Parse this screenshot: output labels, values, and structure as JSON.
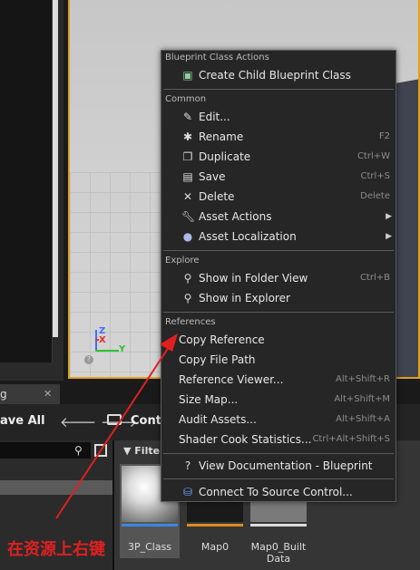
{
  "toolbar": {
    "tab_label": "g",
    "save_all": "ave All",
    "content": "Conte"
  },
  "assets": {
    "filters_label": "Filters",
    "items": [
      {
        "label": "3P_Class"
      },
      {
        "label": "Map0"
      },
      {
        "label": "Map0_Built Data"
      }
    ]
  },
  "context_menu": {
    "sections": {
      "blueprint": "Blueprint Class Actions",
      "common": "Common",
      "explore": "Explore",
      "references": "References"
    },
    "items": {
      "create_child": "Create Child Blueprint Class",
      "edit": "Edit...",
      "rename": "Rename",
      "rename_sc": "F2",
      "duplicate": "Duplicate",
      "duplicate_sc": "Ctrl+W",
      "save": "Save",
      "save_sc": "Ctrl+S",
      "delete": "Delete",
      "delete_sc": "Delete",
      "asset_actions": "Asset Actions",
      "asset_localization": "Asset Localization",
      "show_folder": "Show in Folder View",
      "show_folder_sc": "Ctrl+B",
      "show_explorer": "Show in Explorer",
      "copy_reference": "Copy Reference",
      "copy_file_path": "Copy File Path",
      "reference_viewer": "Reference Viewer...",
      "reference_viewer_sc": "Alt+Shift+R",
      "size_map": "Size Map...",
      "size_map_sc": "Alt+Shift+M",
      "audit_assets": "Audit Assets...",
      "audit_assets_sc": "Alt+Shift+A",
      "shader_cook": "Shader Cook Statistics...",
      "shader_cook_sc": "Ctrl+Alt+Shift+S",
      "view_docs": "View Documentation - Blueprint",
      "connect_source": "Connect To Source Control..."
    }
  },
  "annotation": {
    "text": "在资源上右键",
    "color": "#e02020"
  },
  "gizmo": {
    "z": "Z",
    "x": "X",
    "y": "Y"
  }
}
